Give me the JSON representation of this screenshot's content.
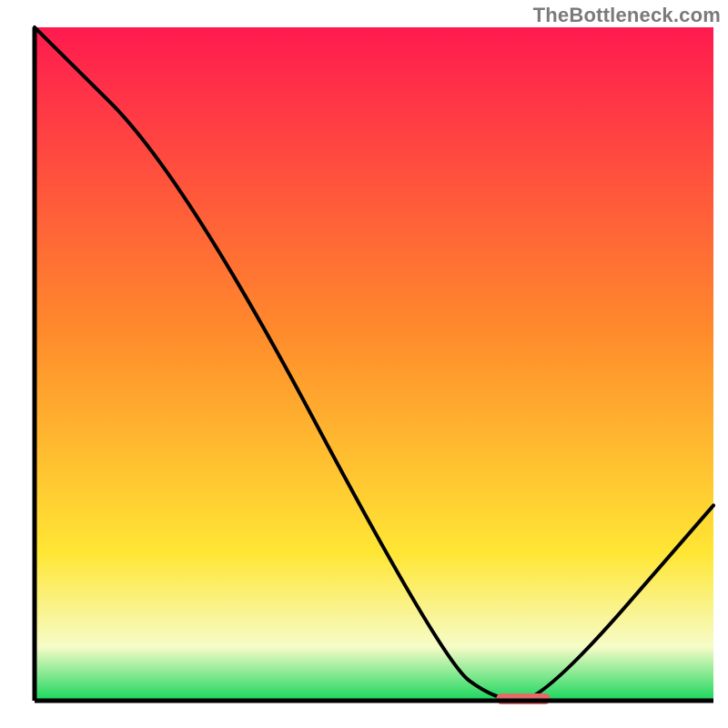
{
  "watermark": "TheBottleneck.com",
  "colors": {
    "curve": "#000000",
    "axis": "#000000",
    "marker": "#e46a6a",
    "grad_top": "#ff1a4f",
    "grad_mid_upper": "#ff8a2b",
    "grad_mid_lower": "#ffe634",
    "grad_whitish": "#f6fcc7",
    "grad_green": "#18d65c"
  },
  "chart_data": {
    "type": "line",
    "title": "",
    "xlabel": "",
    "ylabel": "",
    "xlim": [
      0,
      100
    ],
    "ylim": [
      0,
      100
    ],
    "x": [
      0,
      22,
      60,
      68,
      75,
      100
    ],
    "values": [
      100,
      78,
      6,
      0,
      0,
      29
    ],
    "marker": {
      "x_start": 68,
      "x_end": 76,
      "y": 0
    }
  }
}
